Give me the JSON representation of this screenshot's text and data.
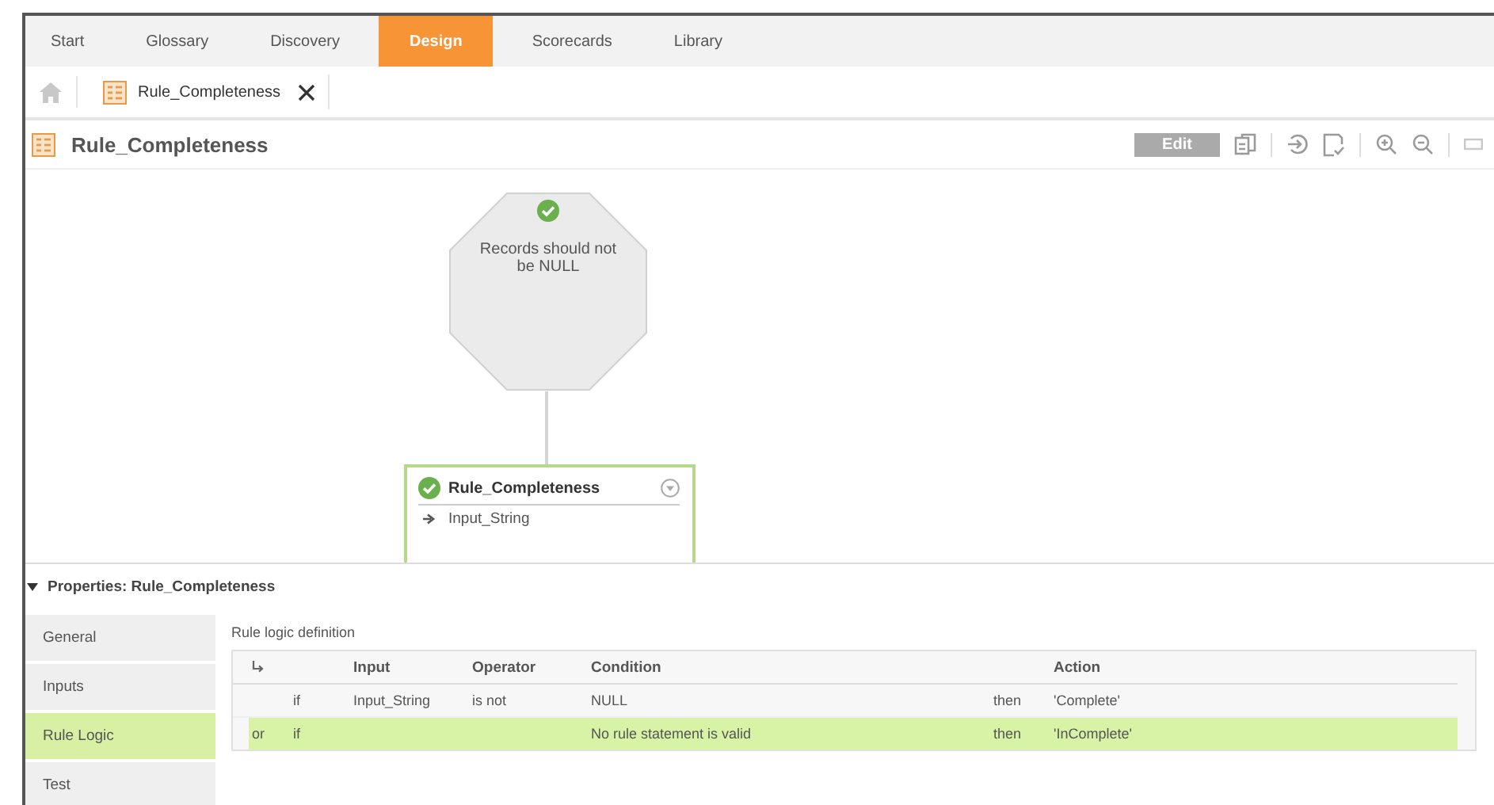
{
  "tabs": [
    {
      "label": "Start",
      "selected": false
    },
    {
      "label": "Glossary",
      "selected": false
    },
    {
      "label": "Discovery",
      "selected": false
    },
    {
      "label": "Design",
      "selected": true
    },
    {
      "label": "Scorecards",
      "selected": false
    },
    {
      "label": "Library",
      "selected": false
    }
  ],
  "breadcrumb": {
    "label": "Rule_Completeness"
  },
  "page_title": "Rule_Completeness",
  "toolbar": {
    "edit_button": "Edit"
  },
  "diagram": {
    "outcome": {
      "text": "Records should not be NULL"
    },
    "rule": {
      "name": "Rule_Completeness",
      "inputs": [
        "Input_String"
      ]
    }
  },
  "properties": {
    "title": "Properties: Rule_Completeness",
    "sections": [
      {
        "label": "General",
        "selected": false
      },
      {
        "label": "Inputs",
        "selected": false
      },
      {
        "label": "Rule Logic",
        "selected": true
      },
      {
        "label": "Test",
        "selected": false
      }
    ],
    "panel_title": "Rule logic definition",
    "table": {
      "columns": [
        "Input",
        "Operator",
        "Condition",
        "Action"
      ],
      "rows": [
        {
          "keyword": "if",
          "input": "Input_String",
          "operator": "is not",
          "condition": "NULL",
          "then": "then",
          "action": "'Complete'",
          "selected": false
        },
        {
          "connector": "or",
          "keyword": "if",
          "condition": "No rule statement is valid",
          "then": "then",
          "action": "'InComplete'",
          "selected": true
        }
      ]
    }
  }
}
